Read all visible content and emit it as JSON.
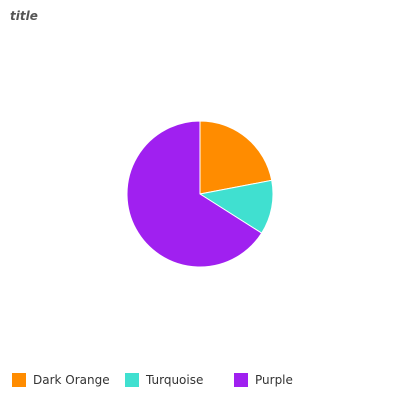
{
  "chart_data": {
    "type": "pie",
    "title": "title",
    "categories": [
      "Dark Orange",
      "Turquoise",
      "Purple"
    ],
    "values": [
      22,
      12,
      66
    ],
    "colors": [
      "#ff8c00",
      "#40e0d0",
      "#a020f0"
    ],
    "legend_position": "bottom",
    "legend": [
      {
        "label": "Dark Orange",
        "color": "#ff8c00"
      },
      {
        "label": "Turquoise",
        "color": "#40e0d0"
      },
      {
        "label": "Purple",
        "color": "#a020f0"
      }
    ]
  }
}
